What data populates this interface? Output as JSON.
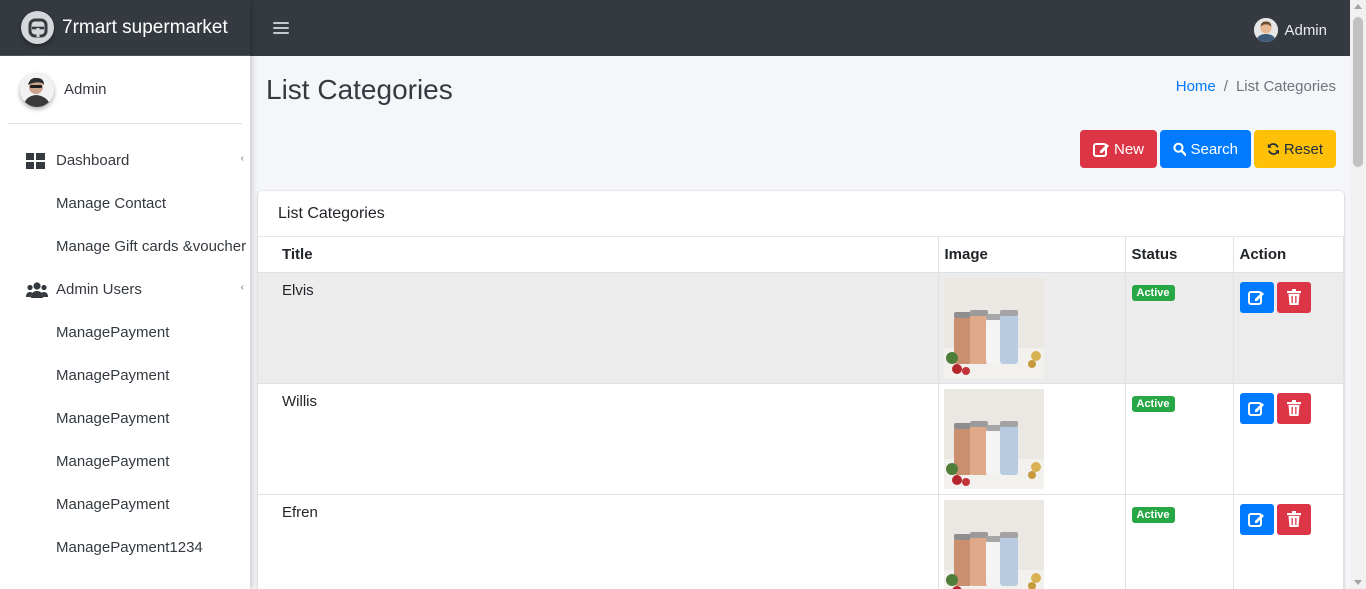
{
  "app": {
    "brand_name": "7rmart supermarket"
  },
  "topbar": {
    "user_name": "Admin"
  },
  "sidebar": {
    "user_name": "Admin",
    "items": [
      {
        "label": "Dashboard",
        "icon": "dashboard-icon",
        "type": "top"
      },
      {
        "label": "Manage Contact",
        "type": "sub"
      },
      {
        "label": "Manage Gift cards &voucher",
        "type": "sub"
      },
      {
        "label": "Admin Users",
        "icon": "users-icon",
        "type": "top"
      },
      {
        "label": "ManagePayment",
        "type": "sub"
      },
      {
        "label": "ManagePayment",
        "type": "sub"
      },
      {
        "label": "ManagePayment",
        "type": "sub"
      },
      {
        "label": "ManagePayment",
        "type": "sub"
      },
      {
        "label": "ManagePayment",
        "type": "sub"
      },
      {
        "label": "ManagePayment1234",
        "type": "sub"
      }
    ]
  },
  "page": {
    "title": "List Categories",
    "breadcrumb": {
      "home": "Home",
      "separator": "/",
      "current": "List Categories"
    }
  },
  "toolbar": {
    "new_label": "New",
    "search_label": "Search",
    "reset_label": "Reset"
  },
  "card": {
    "title": "List Categories"
  },
  "table": {
    "columns": [
      "Title",
      "Image",
      "Status",
      "Action"
    ],
    "rows": [
      {
        "title": "Elvis",
        "status": "Active",
        "highlighted": true
      },
      {
        "title": "Willis",
        "status": "Active",
        "highlighted": false
      },
      {
        "title": "Efren",
        "status": "Active",
        "highlighted": false
      }
    ]
  },
  "colors": {
    "topbar": "#343a40",
    "primary": "#007bff",
    "danger": "#dc3545",
    "warning": "#ffc107",
    "success": "#28a745"
  }
}
